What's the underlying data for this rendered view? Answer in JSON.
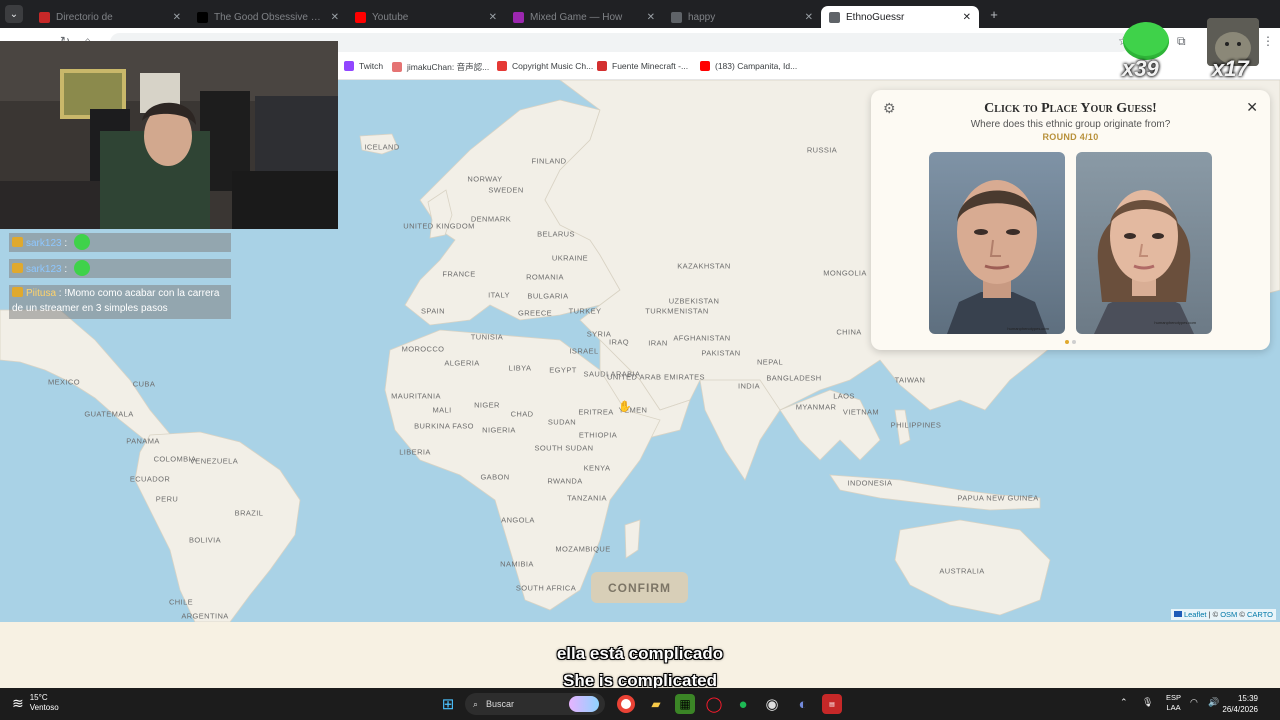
{
  "browser": {
    "tabs": [
      {
        "label": "Directorio de",
        "icon": "af-icon",
        "color": "#c62828",
        "active": false
      },
      {
        "label": "The Good Obsessive Game",
        "icon": "tiktok-icon",
        "color": "#000000",
        "active": false
      },
      {
        "label": "Youtube",
        "icon": "youtube-icon",
        "color": "#ff0000",
        "active": false
      },
      {
        "label": "Mixed Game — How",
        "icon": "chrome-color-icon",
        "color": "#9c27b0",
        "active": false
      },
      {
        "label": "happy",
        "icon": "globe-icon",
        "color": "#5f6368",
        "active": false
      },
      {
        "label": "EthnoGuessr",
        "icon": "globe-icon",
        "color": "#5f6368",
        "active": true
      }
    ],
    "bookmarks": [
      {
        "label": "Twitch",
        "color": "#9146ff"
      },
      {
        "label": "jimakuChan: 音声認...",
        "color": "#e57373"
      },
      {
        "label": "Copyright Music Ch...",
        "color": "#e53935"
      },
      {
        "label": "Fuente Minecraft -...",
        "color": "#d32f2f"
      },
      {
        "label": "(183) Campanita, Id...",
        "color": "#ff0000"
      }
    ]
  },
  "stream": {
    "chat": [
      {
        "user": "sark123",
        "text": ""
      },
      {
        "user": "sark123",
        "text": ""
      },
      {
        "user": "Piitusa",
        "text": "!Momo como acabar con la carrera de un streamer en 3 simples pasos"
      }
    ],
    "emote_count_1": "x39",
    "emote_count_2": "x17",
    "subtitle_es": "ella está complicado",
    "subtitle_en": "She is complicated"
  },
  "map": {
    "labels": [
      "ICELAND",
      "RUSSIA",
      "FINLAND",
      "NORWAY",
      "SWEDEN",
      "UNITED KINGDOM",
      "DENMARK",
      "BELARUS",
      "UKRAINE",
      "KAZAKHSTAN",
      "MONGOLIA",
      "FRANCE",
      "ROMANIA",
      "ITALY",
      "BULGARIA",
      "UZBEKISTAN",
      "SPAIN",
      "GREECE",
      "TURKEY",
      "TURKMENISTAN",
      "TUNISIA",
      "SYRIA",
      "IRAQ",
      "IRAN",
      "AFGHANISTAN",
      "CHINA",
      "MOROCCO",
      "ALGERIA",
      "LIBYA",
      "EGYPT",
      "ISRAEL",
      "SAUDI ARABIA",
      "UNITED ARAB EMIRATES",
      "PAKISTAN",
      "NEPAL",
      "INDIA",
      "BANGLADESH",
      "TAIWAN",
      "MEXICO",
      "CUBA",
      "MAURITANIA",
      "MALI",
      "NIGER",
      "CHAD",
      "SUDAN",
      "ERITREA",
      "YEMEN",
      "MYANMAR",
      "LAOS",
      "VIETNAM",
      "PHILIPPINES",
      "GUATEMALA",
      "PANAMA",
      "BURKINA FASO",
      "NIGERIA",
      "SOUTH SUDAN",
      "ETHIOPIA",
      "COLOMBIA",
      "VENEZUELA",
      "LIBERIA",
      "KENYA",
      "ECUADOR",
      "GABON",
      "RWANDA",
      "INDONESIA",
      "PAPUA NEW GUINEA",
      "PERU",
      "BRAZIL",
      "TANZANIA",
      "ANGOLA",
      "BOLIVIA",
      "MOZAMBIQUE",
      "NAMIBIA",
      "AUSTRALIA",
      "SOUTH AFRICA",
      "CHILE",
      "ARGENTINA"
    ],
    "attribution": {
      "leaflet": "Leaflet",
      "sep": " | © ",
      "osm": "OSM",
      "carto": "CARTO"
    },
    "confirm_label": "CONFIRM"
  },
  "panel": {
    "title": "Click to Place Your Guess!",
    "subtitle": "Where does this ethnic group originate from?",
    "round": "ROUND 4/10",
    "face_captions": [
      "humanphenotypes.com",
      "humanphenotypes.com"
    ],
    "pages": 2,
    "active_page": 1
  },
  "taskbar": {
    "weather_temp": "15°C",
    "weather_desc": "Ventoso",
    "search_label": "Buscar",
    "lang_1": "ESP",
    "lang_2": "LAA",
    "time": "15:39",
    "date": "26/4/2026"
  },
  "colors": {
    "sea": "#a9d2e6",
    "land": "#f2efe7",
    "accent_gold": "#b8913b",
    "confirm_bg": "#d8cfb8"
  }
}
